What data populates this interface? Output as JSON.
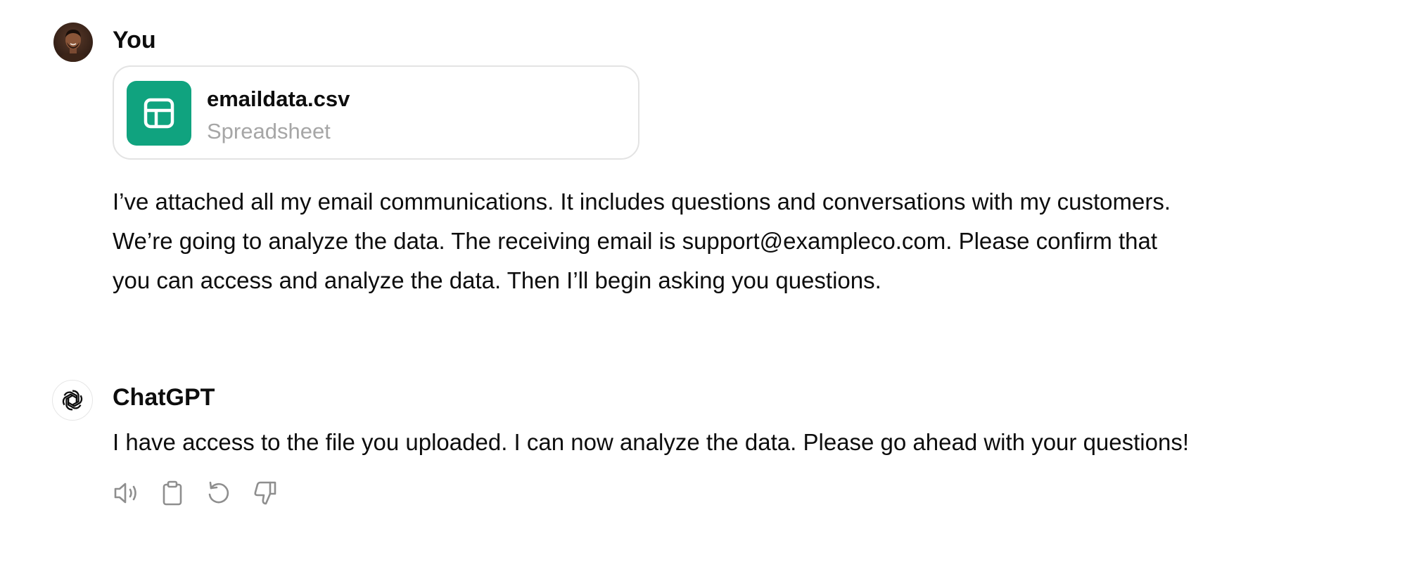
{
  "user_message": {
    "author": "You",
    "attachment": {
      "file_name": "emaildata.csv",
      "file_type": "Spreadsheet",
      "icon": "spreadsheet-icon",
      "icon_color": "#10a37f"
    },
    "lines": [
      "I’ve attached all my email communications. It includes questions and conversations with my customers.",
      "We’re going to analyze the data. The receiving email is support@exampleco.com. Please confirm that",
      "you can access and analyze the data. Then I’ll begin asking you questions."
    ]
  },
  "assistant_message": {
    "author": "ChatGPT",
    "avatar_icon": "openai-logo-icon",
    "text": "I have access to the file you uploaded. I can now analyze the data. Please go ahead with your questions!",
    "actions": [
      "read-aloud-icon",
      "copy-icon",
      "regenerate-icon",
      "thumbs-down-icon"
    ]
  },
  "colors": {
    "text": "#0d0d0d",
    "muted": "#a6a6a6",
    "accent": "#10a37f",
    "border": "#e3e3e3",
    "icon": "#8e8e8e"
  }
}
